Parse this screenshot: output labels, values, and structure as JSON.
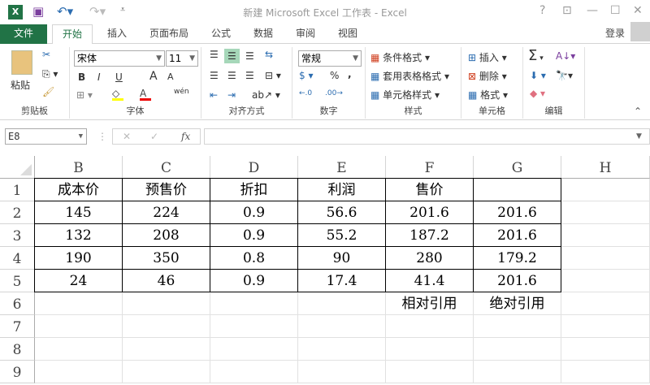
{
  "window": {
    "title": "新建 Microsoft Excel 工作表 - Excel",
    "help": "?",
    "restore_ribbon": "⊡",
    "minimize": "—",
    "maximize": "☐",
    "close": "✕"
  },
  "tabs": [
    "文件",
    "开始",
    "插入",
    "页面布局",
    "公式",
    "数据",
    "审阅",
    "视图"
  ],
  "login": "登录",
  "ribbon": {
    "clipboard": {
      "label": "剪贴板",
      "paste": "粘贴"
    },
    "font": {
      "label": "字体",
      "name": "宋体",
      "size": "11",
      "bold": "B",
      "italic": "I",
      "underline": "U",
      "grow": "A",
      "shrink": "A",
      "wen": "wén"
    },
    "align": {
      "label": "对齐方式"
    },
    "number": {
      "label": "数字",
      "format": "常规",
      "percent": "%",
      "comma": ","
    },
    "styles": {
      "label": "样式",
      "cond": "条件格式",
      "table": "套用表格格式",
      "cell": "单元格样式"
    },
    "cells": {
      "label": "单元格",
      "insert": "插入",
      "delete": "删除",
      "format": "格式"
    },
    "editing": {
      "label": "编辑",
      "sum": "Σ"
    }
  },
  "formula_bar": {
    "name_box": "E8",
    "cancel": "✕",
    "enter": "✓",
    "fx": "fx",
    "value": ""
  },
  "columns": [
    "B",
    "C",
    "D",
    "E",
    "F",
    "G",
    "H"
  ],
  "rows": [
    "1",
    "2",
    "3",
    "4",
    "5",
    "6",
    "7",
    "8",
    "9"
  ],
  "cells": [
    [
      "成本价",
      "预售价",
      "折扣",
      "利润",
      "售价",
      "",
      ""
    ],
    [
      "145",
      "224",
      "0.9",
      "56.6",
      "201.6",
      "201.6",
      ""
    ],
    [
      "132",
      "208",
      "0.9",
      "55.2",
      "187.2",
      "201.6",
      ""
    ],
    [
      "190",
      "350",
      "0.8",
      "90",
      "280",
      "179.2",
      ""
    ],
    [
      "24",
      "46",
      "0.9",
      "17.4",
      "41.4",
      "201.6",
      ""
    ],
    [
      "",
      "",
      "",
      "",
      "相对引用",
      "绝对引用",
      ""
    ],
    [
      "",
      "",
      "",
      "",
      "",
      "",
      ""
    ],
    [
      "",
      "",
      "",
      "",
      "",
      "",
      ""
    ],
    [
      "",
      "",
      "",
      "",
      "",
      "",
      ""
    ]
  ]
}
